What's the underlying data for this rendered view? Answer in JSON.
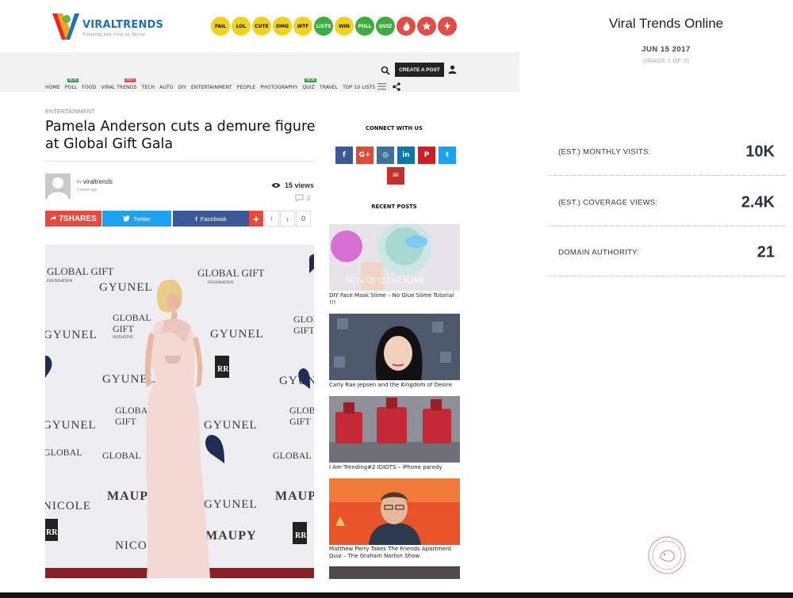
{
  "site": {
    "logo_text": "VIRALTRENDS",
    "logo_tagline": "Trending and Viral on Social"
  },
  "badges": [
    {
      "label": "FAIL",
      "color": "#f4d21b"
    },
    {
      "label": "LOL",
      "color": "#f4d21b"
    },
    {
      "label": "CUTE",
      "color": "#f4d21b"
    },
    {
      "label": "OMG",
      "color": "#f4d21b"
    },
    {
      "label": "WTF",
      "color": "#f4d21b"
    },
    {
      "label": "LISTS",
      "color": "#3cae3e"
    },
    {
      "label": "WIN",
      "color": "#f4d21b"
    },
    {
      "label": "POLL",
      "color": "#3cae3e"
    },
    {
      "label": "QUIZ",
      "color": "#3cae3e"
    },
    {
      "label": "fire-icon",
      "color": "#e34d47"
    },
    {
      "label": "star-icon",
      "color": "#e34d47"
    },
    {
      "label": "bolt-icon",
      "color": "#e34d47"
    }
  ],
  "header": {
    "create_post": "CREATE A POST"
  },
  "menu": {
    "items": [
      "HOME",
      "POLL",
      "FOOD",
      "VIRAL TRENDS",
      "TECH",
      "AUTO",
      "DIY",
      "ENTERTAINMENT",
      "PEOPLE",
      "PHOTOGRAPHY",
      "QUIZ",
      "TRAVEL",
      "TOP 10 LISTS"
    ],
    "tag_new": "NEW",
    "tag_hot": "HOT"
  },
  "article": {
    "category": "ENTERTAINMENT",
    "title": "Pamela Anderson cuts a demure figure at Global Gift Gala",
    "author_by": "By",
    "author": "viraltrends",
    "time": "1 week ago",
    "views": "15 views",
    "comments": "0",
    "shares": "7SHARES",
    "twitter": "Twitter",
    "facebook": "Facebook",
    "plus": "+",
    "vote_score": "0"
  },
  "backdrop": {
    "brand_1": "GLOBAL GIFT",
    "brand_1_sub": "FOUNDATION",
    "brand_2": "GYUNEL",
    "brand_3": "GLOBAL",
    "brand_3b": "GIFT",
    "brand_3_sub": "INITIATIVE",
    "brand_4": "MAUPY",
    "brand_5": "NICOLE",
    "brand_6": "HEART",
    "brand_7": "ROLLS ROYCE"
  },
  "sidebar": {
    "connect_heading": "CONNECT WITH US",
    "social": [
      {
        "name": "facebook",
        "glyph": "f",
        "color": "#3b5998"
      },
      {
        "name": "google-plus",
        "glyph": "G+",
        "color": "#dd4b39"
      },
      {
        "name": "instagram",
        "glyph": "◎",
        "color": "#3f729b"
      },
      {
        "name": "linkedin",
        "glyph": "in",
        "color": "#0e76a8"
      },
      {
        "name": "pinterest",
        "glyph": "P",
        "color": "#cb2027"
      },
      {
        "name": "twitter",
        "glyph": "t",
        "color": "#1da1f2"
      },
      {
        "name": "email",
        "glyph": "✉",
        "color": "#c4302b"
      }
    ],
    "recent_heading": "RECENT POSTS",
    "posts": [
      {
        "title": "DIY Face Mask Slime – No Glue Slime Tutorial !!!",
        "overlay": "NO GLUE CLEAR SLIME"
      },
      {
        "title": "Carly Rae Jepsen and the Kingdom of Desire",
        "overlay": ""
      },
      {
        "title": "I Am Trending#2 IDIOTS – iPhone parody",
        "overlay": ""
      },
      {
        "title": "Matthew Perry Takes The Friends Apartment Quiz – The Graham Norton Show",
        "overlay": ""
      }
    ]
  },
  "panel": {
    "title": "Viral Trends Online",
    "date": "JUN 15 2017",
    "image_index": "(IMAGE 1 OF 2)",
    "stats": [
      {
        "label": "(EST.) MONTHLY VISITS:",
        "value": "10K"
      },
      {
        "label": "(EST.) COVERAGE VIEWS:",
        "value": "2.4K"
      },
      {
        "label": "DOMAIN AUTHORITY:",
        "value": "21"
      }
    ]
  }
}
